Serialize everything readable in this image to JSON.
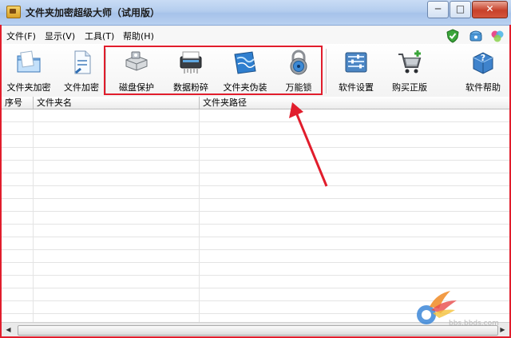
{
  "window": {
    "title": "文件夹加密超级大师（试用版）",
    "controls": {
      "minimize": "─",
      "maximize": "□",
      "close": "✕"
    }
  },
  "menubar": {
    "items": [
      {
        "label": "文件(F)"
      },
      {
        "label": "显示(V)"
      },
      {
        "label": "工具(T)"
      },
      {
        "label": "帮助(H)"
      }
    ],
    "right_icons": [
      "shield-check-icon",
      "phone-icon",
      "color-wheel-icon"
    ]
  },
  "toolbar": {
    "buttons": [
      {
        "label": "文件夹加密",
        "icon": "folder-lock-icon"
      },
      {
        "label": "文件加密",
        "icon": "file-lock-icon"
      },
      {
        "label": "磁盘保护",
        "icon": "disk-protect-icon"
      },
      {
        "label": "数据粉碎",
        "icon": "shredder-icon"
      },
      {
        "label": "文件夹伪装",
        "icon": "folder-disguise-icon"
      },
      {
        "label": "万能锁",
        "icon": "padlock-icon"
      },
      {
        "label": "软件设置",
        "icon": "settings-panel-icon"
      },
      {
        "label": "购买正版",
        "icon": "shopping-cart-icon"
      },
      {
        "label": "软件帮助",
        "icon": "help-icon"
      }
    ]
  },
  "table": {
    "columns": [
      "序号",
      "文件夹名",
      "文件夹路径"
    ],
    "rows": []
  },
  "watermark": {
    "text": "bbs.bbds.com"
  },
  "colors": {
    "annotation_red": "#e11d2c",
    "title_bar": "#b4cdee",
    "close_button": "#c7412a"
  }
}
